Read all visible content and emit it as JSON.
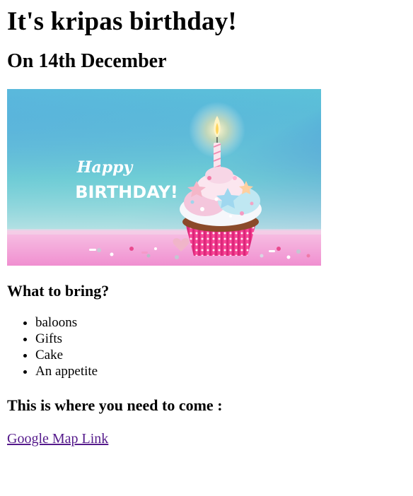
{
  "page": {
    "title": "It's kripas birthday!",
    "date": "On 14th December"
  },
  "banner": {
    "script_text": "Happy",
    "main_text": "BIRTHDAY!"
  },
  "bring": {
    "heading": "What to bring?",
    "items": [
      "baloons",
      "Gifts",
      "Cake",
      "An appetite"
    ]
  },
  "location": {
    "heading": "This is where you need to come :",
    "link_text": "Google Map Link"
  },
  "colors": {
    "link_visited": "#551a8b",
    "sky_top": "#3f6fdc",
    "sky_mid": "#5bc0d6",
    "floor_pink": "#f59ad6"
  }
}
